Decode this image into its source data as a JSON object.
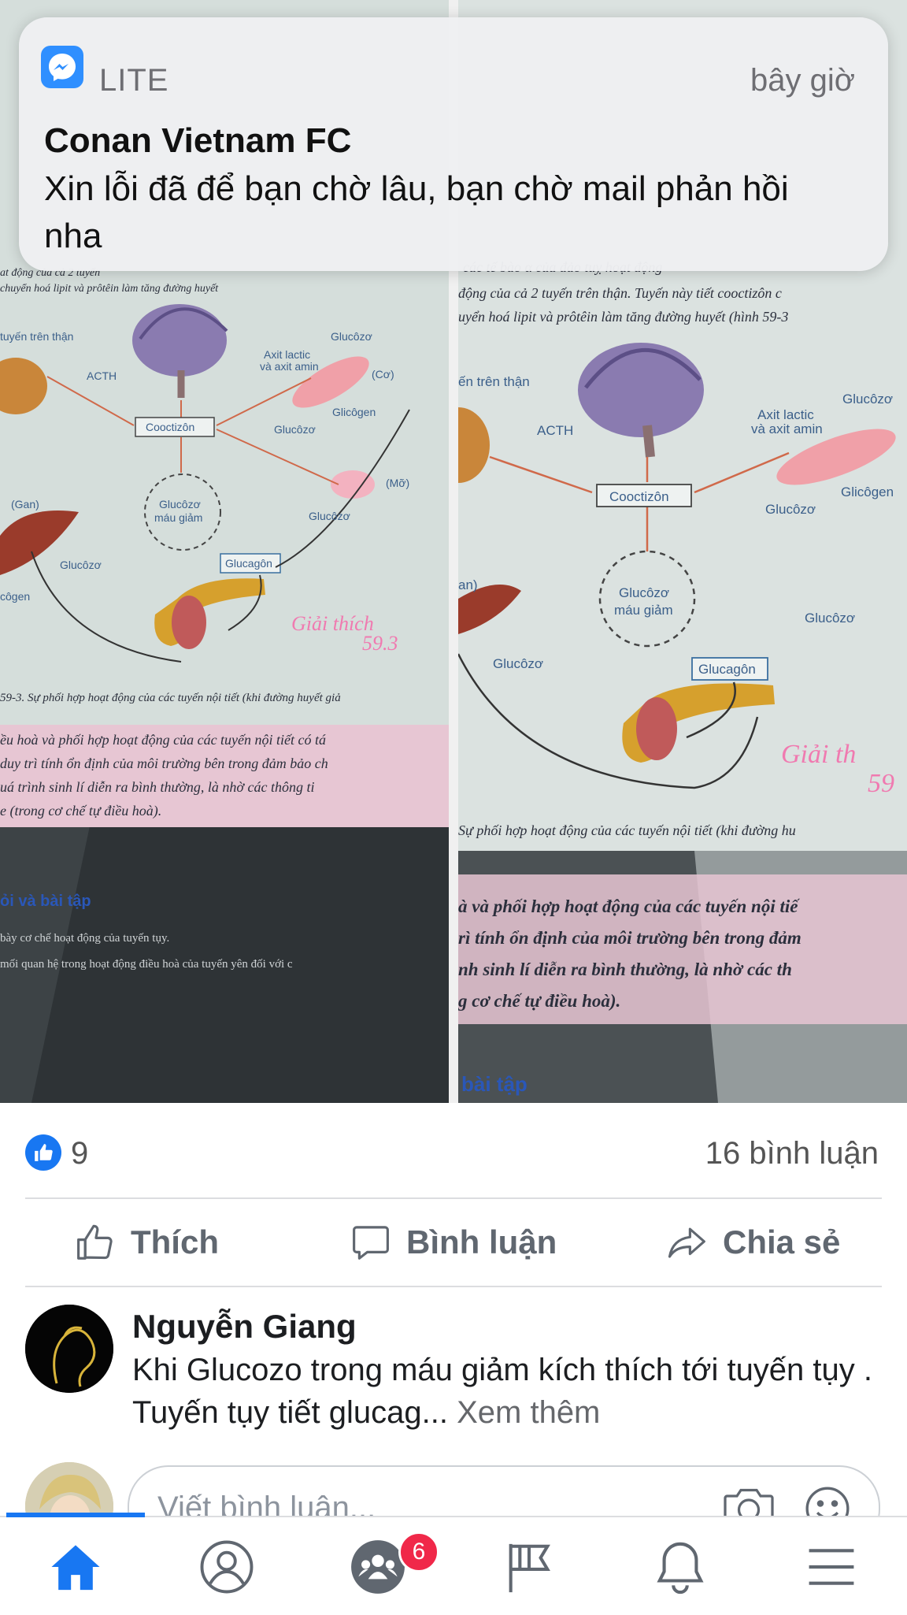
{
  "notification": {
    "app_name": "LITE",
    "time": "bây giờ",
    "title": "Conan Vietnam FC",
    "message": "Xin lỗi đã để bạn chờ lâu, bạn chờ mail phản hồi nha",
    "icon": "messenger-icon"
  },
  "photos": {
    "left": {
      "caption": "59-3. Sự phối hợp hoạt động của các tuyến nội tiết (khi đường huyết giả",
      "header_line1": "at động của cả 2 tuyến",
      "header_line2": "chuyển hoá lipit và prôtêin làm tăng đường huyết",
      "labels": {
        "adrenal": "tuyến trên thận",
        "acth": "ACTH",
        "axit": "Axit lactic",
        "axit2": "và axit amin",
        "glucozo_top": "Glucôzơ",
        "co": "(Cơ)",
        "cooctizon": "Cooctizôn",
        "glucozo_mid": "Glucôzơ",
        "glicogen": "Glicôgen",
        "mo": "(Mỡ)",
        "gan": "(Gan)",
        "glucozo_mau1": "Glucôzơ",
        "glucozo_mau2": "máu giảm",
        "glucozo_right": "Glucôzơ",
        "glucozo_low": "Glucôzơ",
        "glucagon": "Glucagôn",
        "cogen": "côgen",
        "note": "Giải thích",
        "note_num": "59.3"
      },
      "pink_lines": [
        "ều hoà và phối hợp hoạt động của các tuyến nội tiết có tá",
        "duy trì tính ổn định của môi trường bên trong đảm bảo ch",
        "uá trình sinh lí diễn ra bình thường, là nhờ các thông ti",
        "e (trong cơ chế tự điều hoà)."
      ],
      "questions_title": "ỏi và bài tập",
      "question1": "bày cơ chế hoạt động của tuyến tụy.",
      "question2": "mối quan hệ trong hoạt động điều hoà của tuyến yên đối với c"
    },
    "right": {
      "header_line1": "các tế bào α của đảo tuỵ hoạt động",
      "header_line2": "động của cả 2 tuyến trên thận. Tuyến này tiết cooctizôn c",
      "header_line3": "uyển hoá lipit và prôtêin làm tăng đường huyết (hình 59-3",
      "caption": "Sự phối hợp hoạt động của các tuyến nội tiết (khi đường hu",
      "labels": {
        "adrenal": "ến trên thận",
        "acth": "ACTH",
        "axit": "Axit lactic",
        "axit2": "và axit amin",
        "glucozo_top": "Glucôzơ",
        "cooctizon": "Cooctizôn",
        "glucozo_mid": "Glucôzơ",
        "glicogen": "Glicôgen",
        "gan": "an)",
        "glucozo_mau1": "Glucôzơ",
        "glucozo_mau2": "máu giảm",
        "glucozo_right": "Glucôzơ",
        "glucozo_low": "Glucôzơ",
        "glucagon": "Glucagôn",
        "note": "Giải th",
        "note_num": "59"
      },
      "pink_lines": [
        "à và phối hợp hoạt động của các tuyến nội tiế",
        "rì tính ổn định của môi trường bên trong đảm",
        "nh sinh lí diễn ra bình thường, là nhờ các th",
        "g cơ chế tự điều hoà)."
      ],
      "questions_title": "bài tập"
    }
  },
  "reactions": {
    "like_count": "9",
    "comment_count": "16 bình luận"
  },
  "actions": {
    "like": "Thích",
    "comment": "Bình luận",
    "share": "Chia sẻ"
  },
  "comment": {
    "author": "Nguyễn Giang",
    "text": "Khi Glucozo trong máu giảm kích thích tới tuyến tụy . Tuyến tụy tiết glucag...",
    "see_more": "Xem thêm"
  },
  "composer": {
    "placeholder": "Viết bình luận..."
  },
  "tabbar": {
    "items": [
      "home-icon",
      "profile-icon",
      "groups-icon",
      "pages-icon",
      "notifications-icon",
      "menu-icon"
    ],
    "groups_badge": "6",
    "accent": "#1877f2"
  }
}
